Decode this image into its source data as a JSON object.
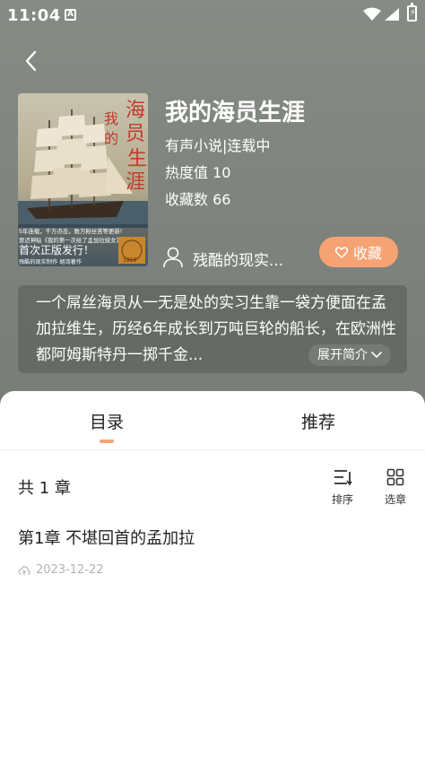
{
  "status_bar": {
    "time": "11:04",
    "notification_letter": "A"
  },
  "book": {
    "title": "我的海员生涯",
    "category_status": "有声小说|连载中",
    "popularity": "热度值 10",
    "favorites": "收藏数 66",
    "author": "残酷的现实...",
    "favorite_button": "收藏",
    "synopsis": "一个屌丝海员从一无是处的实习生靠一袋方便面在孟加拉维生，历经6年成长到万吨巨轮的船长，在欧洲性都阿姆斯特丹一掷千金...",
    "expand_button": "展开简介"
  },
  "cover": {
    "title_chars": [
      "海",
      "员",
      "生",
      "涯"
    ],
    "prefix_chars": [
      "我",
      "的"
    ],
    "promo_line1": "5年连载，千万点击，数万粉丝苦等更新!",
    "promo_line2": "贾迟神贴《我的第一次给了孟加拉妓女》",
    "release": "首次正版发行！",
    "byline": "残酷的现实制作  胡湾著作",
    "stamp_year": "1950"
  },
  "tabs": [
    {
      "label": "目录"
    },
    {
      "label": "推荐"
    }
  ],
  "toc": {
    "count": "共 1 章",
    "sort_label": "排序",
    "select_label": "选章",
    "chapters": [
      {
        "title": "第1章 不堪回首的孟加拉",
        "date": "2023-12-22"
      }
    ]
  },
  "colors": {
    "accent": "#f6a374",
    "hero_bg": "#838882"
  }
}
